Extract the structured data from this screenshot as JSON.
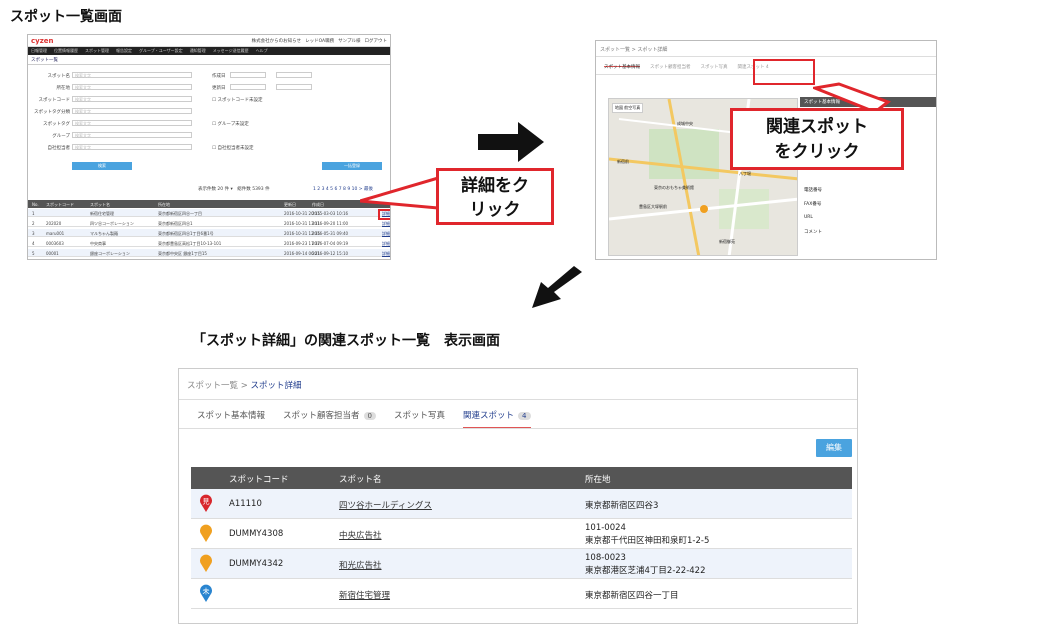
{
  "headings": {
    "top": "スポット一覧画面",
    "bottom": "「スポット詳細」の関連スポット一覧　表示画面"
  },
  "callouts": {
    "detail": [
      "詳細をク",
      "リック"
    ],
    "related": [
      "関連スポット",
      "をクリック"
    ]
  },
  "list_screen": {
    "logo": "cyzen",
    "top_right": [
      "株式会社からのお知らせ",
      "レッドOA職務",
      "サンプル様",
      "ログアウト"
    ],
    "menu": [
      "日報管理",
      "位置情報履歴",
      "スポット管理",
      "報告設定",
      "グループ・ユーザー設定",
      "通知管理",
      "メッセージ送信履歴",
      "ヘルプ"
    ],
    "breadcrumb": "スポット一覧",
    "form_labels_left": [
      "スポット名",
      "所在地",
      "スポットコード",
      "スポットタグ分類",
      "スポットタグ",
      "グループ",
      "自社担当者"
    ],
    "form_labels_right": [
      "作成日",
      "更新日"
    ],
    "checkbox_labels": [
      "スポットコード未設定",
      "グループ未設定",
      "自社担当者未設定"
    ],
    "placeholder": "検索文字",
    "search_label": "検索",
    "batch_label": "一括登録",
    "count_text": "表示件数 20 件 ▾　総件数 5393 件",
    "pager": "1 2 3 4 5 6 7 8 9 10 > 最後",
    "columns": [
      "No.",
      "スポットコード",
      "スポット名",
      "所在地",
      "更新日",
      "作成日"
    ],
    "rows": [
      [
        "1",
        "",
        "新宿住宅管理",
        "東京都新宿区四谷一丁目",
        "2016-10-31 20:15",
        "2015-03-03 10:16",
        "詳細"
      ],
      [
        "2",
        "202020",
        "四ツ谷コーポレーション",
        "東京都新宿区四谷1",
        "2016-10-31 13:11",
        "2016-09-20 11:00",
        "詳細"
      ],
      [
        "3",
        "maru001",
        "マルちゃん製麺",
        "東京都新宿区四谷1丁目6番1号",
        "2016-10-31 12:35",
        "2016-05-31 09:40",
        "詳細"
      ],
      [
        "4",
        "0003603",
        "中央商事",
        "東京都豊島区高松1丁目10-13-101",
        "2016-09-23 17:37",
        "2016-07-04 09:19",
        "詳細"
      ],
      [
        "5",
        "00001",
        "銀座コーポレーション",
        "東京都中央区 銀座1丁目15",
        "2016-09-14 06:21",
        "2016-09-12 15:10",
        "詳細"
      ]
    ]
  },
  "detail_preview": {
    "breadcrumb": "スポット一覧 > スポット詳細",
    "tabs": [
      "スポット基本情報",
      "スポット顧客担当者",
      "スポット写真",
      "関連スポット 4"
    ],
    "side_header": "スポット基本情報",
    "side_items": [
      "電話番号",
      "FAX番号",
      "URL",
      "コメント"
    ],
    "map_labels": [
      "地図",
      "航空写真",
      "成城中央",
      "東京のおもちゃ美術館",
      "豊島区大塚駅前",
      "八丁堀",
      "新宿御苑",
      "新宿前"
    ]
  },
  "related_screen": {
    "breadcrumb_prefix": "スポット一覧 > ",
    "breadcrumb_current": "スポット詳細",
    "tabs": [
      {
        "label": "スポット基本情報",
        "badge": ""
      },
      {
        "label": "スポット顧客担当者",
        "badge": "0"
      },
      {
        "label": "スポット写真",
        "badge": ""
      },
      {
        "label": "関連スポット",
        "badge": "4"
      }
    ],
    "edit_label": "編集",
    "columns": [
      "",
      "スポットコード",
      "スポット名",
      "所在地"
    ],
    "rows": [
      {
        "pin": "見",
        "pin_color": "#d8262c",
        "code": "A11110",
        "name": "四ツ谷ホールディングス",
        "address1": "東京都新宿区四谷3",
        "address2": ""
      },
      {
        "pin": "",
        "pin_color": "#f0a020",
        "code": "DUMMY4308",
        "name": "中央広告社",
        "address1": "101-0024",
        "address2": "東京都千代田区神田和泉町1-2-5"
      },
      {
        "pin": "",
        "pin_color": "#f0a020",
        "code": "DUMMY4342",
        "name": "和光広告社",
        "address1": "108-0023",
        "address2": "東京都港区芝浦4丁目2-22-422"
      },
      {
        "pin": "未",
        "pin_color": "#2a85d0",
        "code": "",
        "name": "新宿住宅管理",
        "address1": "東京都新宿区四谷一丁目",
        "address2": ""
      }
    ]
  },
  "colors": {
    "accent": "#4aa3df",
    "callout_red": "#e0262c",
    "active_tab": "#25408f"
  }
}
